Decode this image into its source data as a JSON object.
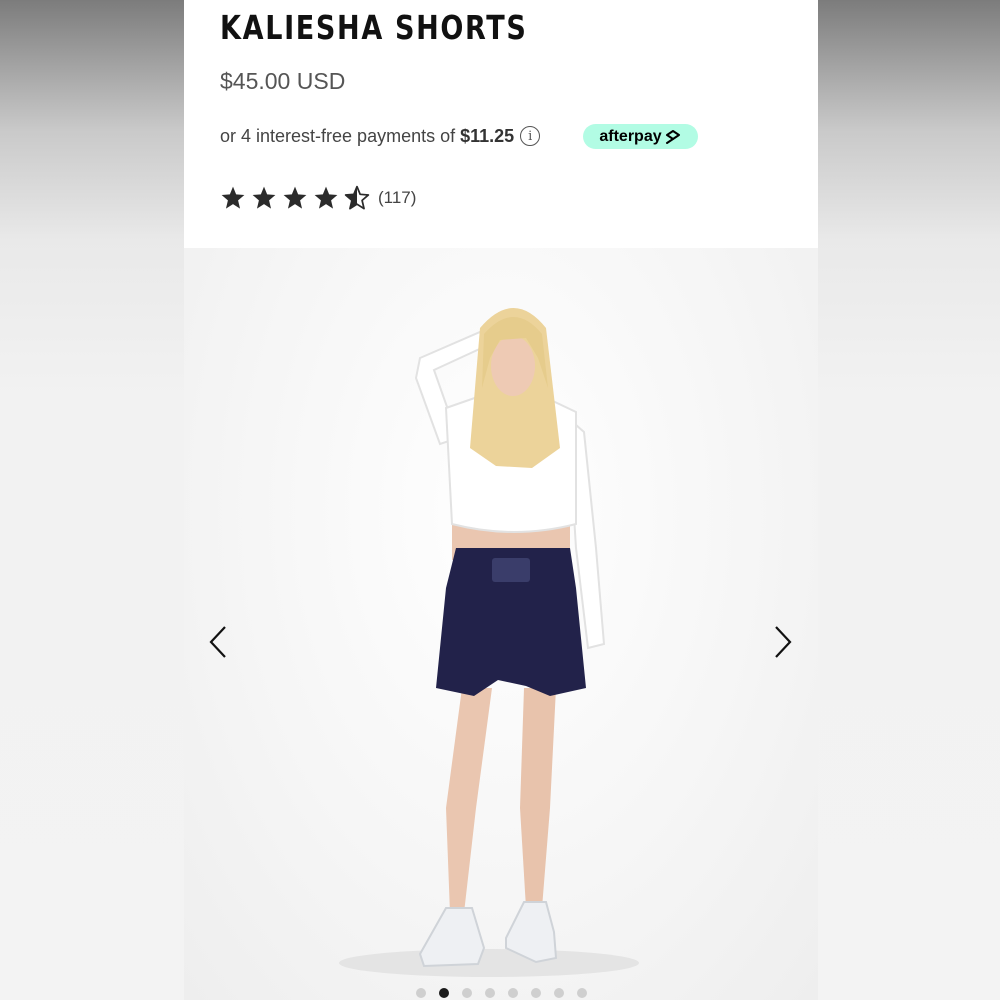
{
  "product": {
    "title": "KALIESHA SHORTS",
    "price": "$45.00 USD",
    "installments": {
      "prefix": "or 4 interest-free payments of",
      "amount": "$11.25",
      "info_icon": "info-icon",
      "provider_label": "afterpay",
      "provider_color": "#b2fce4"
    },
    "rating": {
      "stars": 4.5,
      "max_stars": 5,
      "count_label": "(117)",
      "star_color": "#2b2b2b"
    }
  },
  "gallery": {
    "image_description_icon": "product-photo",
    "prev_icon": "chevron-left-icon",
    "next_icon": "chevron-right-icon",
    "slide_count": 8,
    "active_slide": 2,
    "shorts_color": "#22224a",
    "top_color": "#ffffff"
  }
}
